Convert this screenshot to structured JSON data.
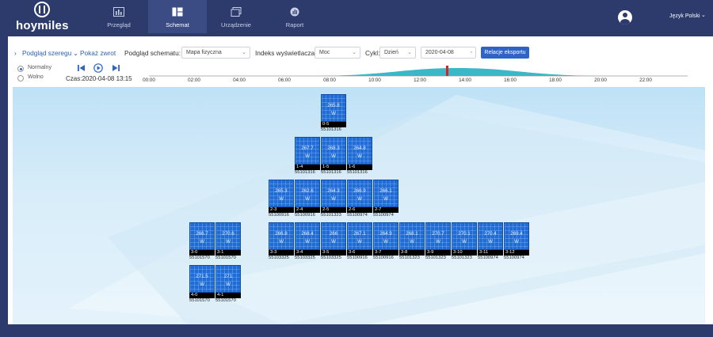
{
  "brand": {
    "name": "hoymiles"
  },
  "nav": [
    {
      "label": "Przegląd",
      "icon": "overview-icon",
      "active": false
    },
    {
      "label": "Schemat",
      "icon": "layout-icon",
      "active": true
    },
    {
      "label": "Urządzenie",
      "icon": "device-icon",
      "active": false
    },
    {
      "label": "Raport",
      "icon": "report-icon",
      "active": false
    }
  ],
  "user": {
    "icon": "user-avatar-icon",
    "language": "Język Polski"
  },
  "toolbar": {
    "view_string": "Podgląd szeregu",
    "show_collapse": "Pokaż zwrot",
    "schema_label": "Podgląd schematu:",
    "schema_value": "Mapa fizyczna",
    "index_label": "Indeks wyświetlacza:",
    "index_value": "Moc",
    "cycle_label": "Cykl:",
    "cycle_value": "Dzień",
    "date_value": "2020-04-08",
    "export_button": "Relacje eksportu"
  },
  "playback": {
    "mode_normal": "Normalny",
    "mode_slow": "Wolno",
    "time_label": "Czas:2020-04-08 13:15"
  },
  "timeline": {
    "ticks": [
      "00:00",
      "02:00",
      "04:00",
      "06:00",
      "08:00",
      "10:00",
      "12:00",
      "14:00",
      "16:00",
      "18:00",
      "20:00",
      "22:00"
    ],
    "current_hour": 13.25
  },
  "modules": [
    {
      "value": "265.8",
      "unit": "W",
      "id": "0-5",
      "sn": "55101316"
    },
    {
      "value": "267.7",
      "unit": "W",
      "id": "1-4",
      "sn": "55101316"
    },
    {
      "value": "268.3",
      "unit": "W",
      "id": "1-5",
      "sn": "55101316"
    },
    {
      "value": "264.8",
      "unit": "W",
      "id": "1-6",
      "sn": "55101316"
    },
    {
      "value": "265.3",
      "unit": "W",
      "id": "2-3",
      "sn": "55100916"
    },
    {
      "value": "262.6",
      "unit": "W",
      "id": "2-4",
      "sn": "55100916"
    },
    {
      "value": "264.3",
      "unit": "W",
      "id": "2-5",
      "sn": "55101323"
    },
    {
      "value": "266.9",
      "unit": "W",
      "id": "2-6",
      "sn": "55100974"
    },
    {
      "value": "266.1",
      "unit": "W",
      "id": "2-7",
      "sn": "55100974"
    },
    {
      "value": "266.7",
      "unit": "W",
      "id": "3-0",
      "sn": "55101570"
    },
    {
      "value": "270.6",
      "unit": "W",
      "id": "3-1",
      "sn": "55101570"
    },
    {
      "value": "266.8",
      "unit": "W",
      "id": "3-3",
      "sn": "55103325"
    },
    {
      "value": "268.4",
      "unit": "W",
      "id": "3-4",
      "sn": "55103325"
    },
    {
      "value": "266",
      "unit": "W",
      "id": "3-5",
      "sn": "55103325"
    },
    {
      "value": "267.1",
      "unit": "W",
      "id": "3-6",
      "sn": "55100916"
    },
    {
      "value": "264.9",
      "unit": "W",
      "id": "3-7",
      "sn": "55100916"
    },
    {
      "value": "268.1",
      "unit": "W",
      "id": "3-8",
      "sn": "55101323"
    },
    {
      "value": "270.7",
      "unit": "W",
      "id": "3-9",
      "sn": "55101323"
    },
    {
      "value": "270.1",
      "unit": "W",
      "id": "3-10",
      "sn": "55101323"
    },
    {
      "value": "270.4",
      "unit": "W",
      "id": "3-11",
      "sn": "55100974"
    },
    {
      "value": "269.4",
      "unit": "W",
      "id": "3-12",
      "sn": "55100974"
    },
    {
      "value": "271.5",
      "unit": "W",
      "id": "4-0",
      "sn": "55101570"
    },
    {
      "value": "271",
      "unit": "W",
      "id": "4-1",
      "sn": "55101570"
    }
  ],
  "colors": {
    "accent": "#2e64c6",
    "header": "#2d3a6c",
    "module": "#1f6cd6",
    "timeline_marker": "#e02020",
    "timeline_fill": "#3bb8c8"
  }
}
